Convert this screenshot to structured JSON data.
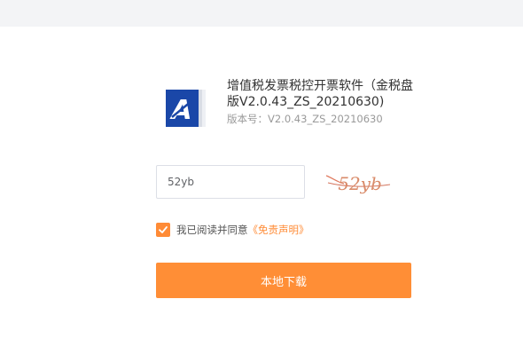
{
  "app": {
    "title": "增值税发票税控开票软件（金税盘版V2.0.43_ZS_20210630)",
    "version_label": "版本号：",
    "version_value": "V2.0.43_ZS_20210630",
    "logo_icon": "aisino-logo-icon"
  },
  "captcha": {
    "input_value": "52yb",
    "image_text": "52yb"
  },
  "agreement": {
    "checked": true,
    "text": "我已阅读并同意",
    "link_text": "《免责声明》"
  },
  "download": {
    "label": "本地下载"
  },
  "colors": {
    "accent": "#ff8e36",
    "text": "#333333",
    "muted": "#999999",
    "top_strip": "#f3f4f6"
  }
}
